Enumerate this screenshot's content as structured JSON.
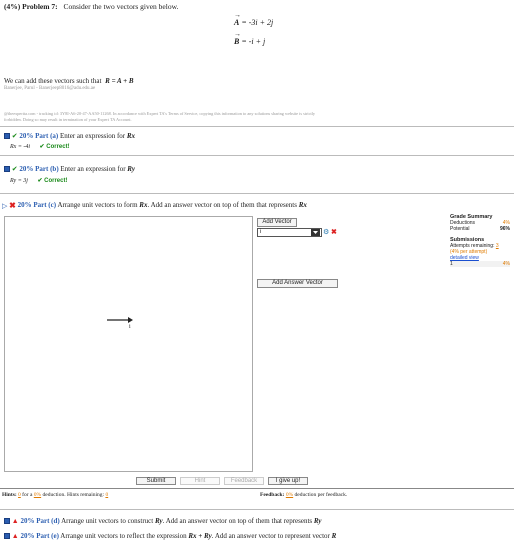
{
  "problem": {
    "weight": "(4%)",
    "title": "Problem 7:",
    "statement": "Consider the two vectors given below."
  },
  "equations": {
    "a_lhs": "A",
    "a_rhs": "= -3i + 2j",
    "b_lhs": "B",
    "b_rhs": "= -i + j"
  },
  "intro": {
    "text": "We can add these vectors such that",
    "formula_r": "R",
    "formula_rest": "= A + B"
  },
  "student_line": "Banerjee, Parul - Banerjeep8016@adu.edu.ae",
  "watermark_line1": "@theexpertta.com - tracking id: 3Y8I-A6-20-47-AA50-11268. In accordance with Expert TA's Terms of Service, copying this information to any solutions sharing website is strictly",
  "watermark_line2": "forbidden. Doing so may result in termination of your Expert TA Account.",
  "part_a": {
    "label": "20% Part (a)",
    "text": "Enter an expression for",
    "var": "Rx",
    "answer": "Rx = -4i",
    "status": "Correct!"
  },
  "part_b": {
    "label": "20% Part (b)",
    "text": "Enter an expression for",
    "var": "Ry",
    "answer": "Ry = 3j",
    "status": "Correct!"
  },
  "part_c": {
    "label": "20% Part (c)",
    "text": "Arrange unit vectors to form",
    "var": "Rx",
    "text2": ". Add an answer vector on top of them that represents",
    "var2": "Rx"
  },
  "controls": {
    "add_vector": "Add Vector",
    "select_value": "i",
    "add_answer_vector": "Add Answer Vector",
    "canvas_vector_label": "i"
  },
  "grade_summary": {
    "title": "Grade Summary",
    "deductions_label": "Deductions",
    "deductions_value": "4%",
    "potential_label": "Potential",
    "potential_value": "96%",
    "submissions_title": "Submissions",
    "attempts_label": "Attempts remaining:",
    "attempts_value": "3",
    "per_attempt": "(4% per attempt)",
    "detailed_view": "detailed view",
    "sub_number": "1",
    "sub_value": "4%"
  },
  "buttons": {
    "submit": "Submit",
    "hint": "Hint",
    "feedback": "Feedback",
    "give_up": "I give up!"
  },
  "hints": {
    "label": "Hints:",
    "count": "0",
    "for_a": "for a",
    "pct": "0%",
    "deduction": "deduction. Hints remaining:",
    "remaining": "0"
  },
  "feedback": {
    "label": "Feedback:",
    "pct": "0%",
    "text": "deduction per feedback."
  },
  "part_d": {
    "label": "20% Part (d)",
    "text": "Arrange unit vectors to construct",
    "var": "Ry",
    "text2": ". Add an answer vector on top of them that represents",
    "var2": "Ry"
  },
  "part_e": {
    "label": "20% Part (e)",
    "text": "Arrange unit vectors to reflect the expression",
    "var": "Rx + Ry",
    "text2": ". Add an answer vector to represent vector",
    "var2": "R"
  },
  "colors": {
    "link": "#1a4fd0",
    "correct": "#1a8a1a",
    "part": "#2a5db0",
    "warning": "#e07b00"
  }
}
